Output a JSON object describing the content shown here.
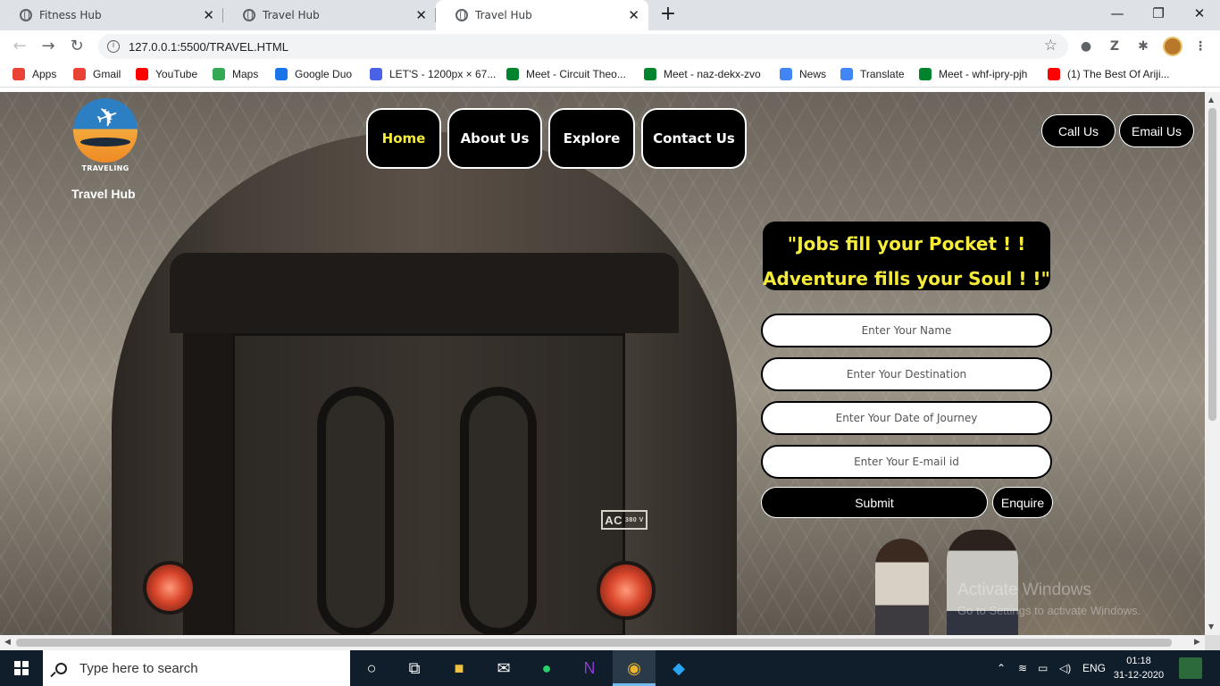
{
  "browser": {
    "tabs": [
      {
        "title": "Fitness Hub",
        "active": false
      },
      {
        "title": "Travel Hub",
        "active": false
      },
      {
        "title": "Travel Hub",
        "active": true
      }
    ],
    "url": "127.0.0.1:5500/TRAVEL.HTML",
    "bookmarks": [
      {
        "label": "Apps",
        "icon": "apps-grid-icon",
        "color": "#ea4335"
      },
      {
        "label": "Gmail",
        "icon": "gmail-icon",
        "color": "#ea4335"
      },
      {
        "label": "YouTube",
        "icon": "youtube-icon",
        "color": "#ff0000"
      },
      {
        "label": "Maps",
        "icon": "maps-pin-icon",
        "color": "#34a853"
      },
      {
        "label": "Google Duo",
        "icon": "duo-icon",
        "color": "#1a73e8"
      },
      {
        "label": "LET'S - 1200px × 67...",
        "icon": "chrome-c-icon",
        "color": "#4a62e8"
      },
      {
        "label": "Meet - Circuit Theo...",
        "icon": "meet-icon",
        "color": "#00832d"
      },
      {
        "label": "Meet - naz-dekx-zvo",
        "icon": "meet-icon",
        "color": "#00832d"
      },
      {
        "label": "News",
        "icon": "news-icon",
        "color": "#4285f4"
      },
      {
        "label": "Translate",
        "icon": "translate-icon",
        "color": "#4285f4"
      },
      {
        "label": "Meet - whf-ipry-pjh",
        "icon": "meet-icon",
        "color": "#00832d"
      },
      {
        "label": "(1) The Best Of Ariji...",
        "icon": "youtube-icon",
        "color": "#ff0000"
      }
    ],
    "ext_z": "Z"
  },
  "site": {
    "logo_tagline": "TRAVELING",
    "brand": "Travel Hub",
    "nav": [
      "Home",
      "About Us",
      "Explore",
      "Contact Us"
    ],
    "contact": {
      "call": "Call Us",
      "email": "Email Us"
    },
    "quote_line1": "\"Jobs fill your Pocket ! !",
    "quote_line2": "Adventure fills your Soul ! !\"",
    "form": {
      "name_placeholder": "Enter Your Name",
      "destination_placeholder": "Enter Your Destination",
      "date_placeholder": "Enter Your Date of Journey",
      "email_placeholder": "Enter Your E-mail id",
      "submit": "Submit",
      "enquire": "Enquire"
    },
    "image_plate": "AC",
    "image_plate_small": "380 V"
  },
  "os": {
    "watermark_title": "Activate Windows",
    "watermark_sub": "Go to Settings to activate Windows.",
    "search_placeholder": "Type here to search",
    "language": "ENG",
    "time": "01:18",
    "date": "31-12-2020"
  },
  "colors": {
    "accent_yellow": "#f5ec3a",
    "button_black": "#000000",
    "taskbar": "#101e2b"
  }
}
